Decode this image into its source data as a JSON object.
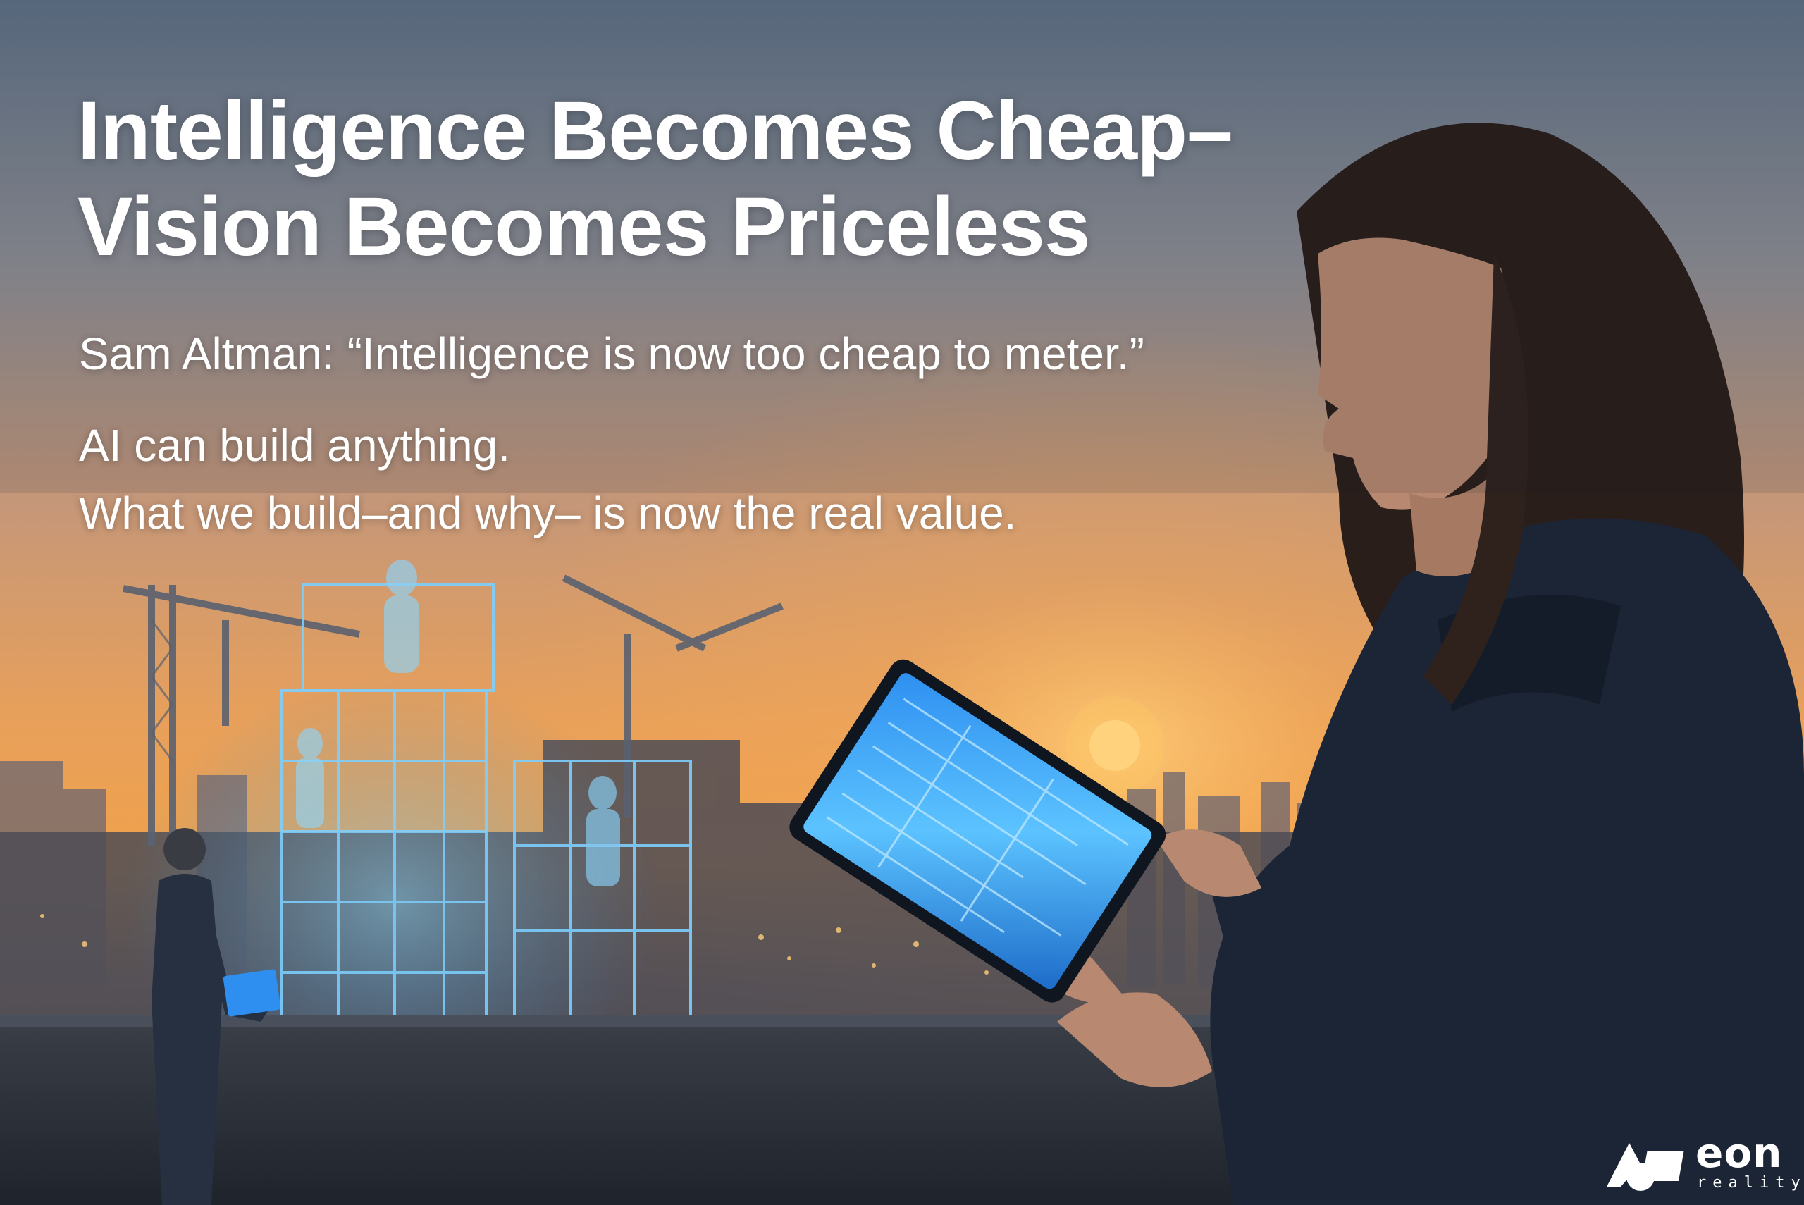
{
  "headline": {
    "line1": "Intelligence Becomes Cheap–",
    "line2": "Vision Becomes Priceless"
  },
  "quote": "Sam Altman: “Intelligence is now too cheap to meter.”",
  "body": {
    "line1": "AI can build anything.",
    "line2": "What we build–and why– is now the real value."
  },
  "logo": {
    "wordmark": "eon",
    "subtitle": "reality"
  },
  "colors": {
    "sky_top": "#5f7186",
    "sky_mid": "#d3956a",
    "sky_horizon": "#f1a84f",
    "hologram": "#4fb8ff",
    "hoodie": "#1c2535",
    "text": "#ffffff"
  }
}
